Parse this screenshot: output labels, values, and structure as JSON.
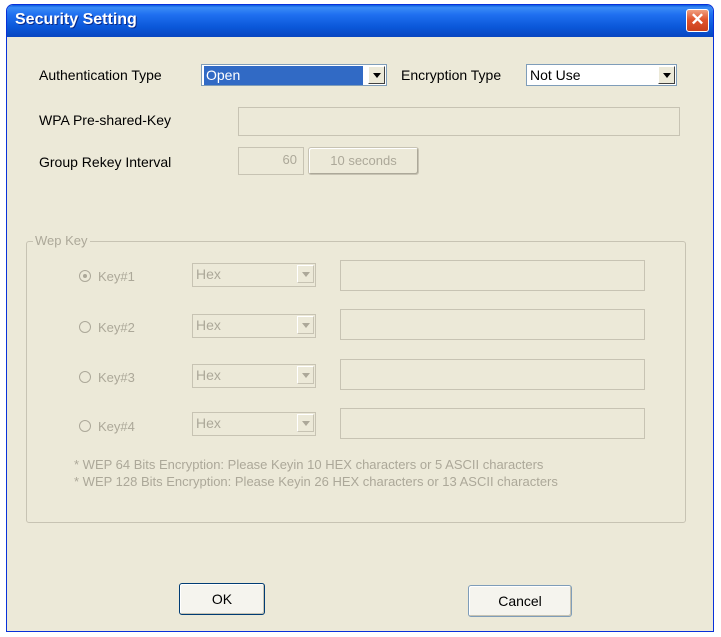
{
  "window": {
    "title": "Security Setting",
    "close_glyph": "✕"
  },
  "auth": {
    "label": "Authentication Type",
    "value": "Open"
  },
  "encryption": {
    "label": "Encryption Type",
    "value": "Not Use"
  },
  "wpa": {
    "label": "WPA Pre-shared-Key",
    "value": ""
  },
  "rekey": {
    "label": "Group Rekey Interval",
    "value": "60",
    "unit_label": "10 seconds"
  },
  "wep": {
    "legend": "Wep Key",
    "keys": [
      {
        "label": "Key#1",
        "format": "Hex",
        "value": "",
        "selected": true
      },
      {
        "label": "Key#2",
        "format": "Hex",
        "value": "",
        "selected": false
      },
      {
        "label": "Key#3",
        "format": "Hex",
        "value": "",
        "selected": false
      },
      {
        "label": "Key#4",
        "format": "Hex",
        "value": "",
        "selected": false
      }
    ],
    "note1": "* WEP   64 Bits Encryption:  Please Keyin 10 HEX characters or   5 ASCII characters",
    "note2": "* WEP 128 Bits Encryption:  Please Keyin 26 HEX characters or 13 ASCII characters"
  },
  "buttons": {
    "ok": "OK",
    "cancel": "Cancel"
  },
  "colors": {
    "title_bar": "#0a57d8",
    "dialog_bg": "#ece9d8",
    "selection": "#316ac5",
    "disabled_text": "#aca899"
  }
}
